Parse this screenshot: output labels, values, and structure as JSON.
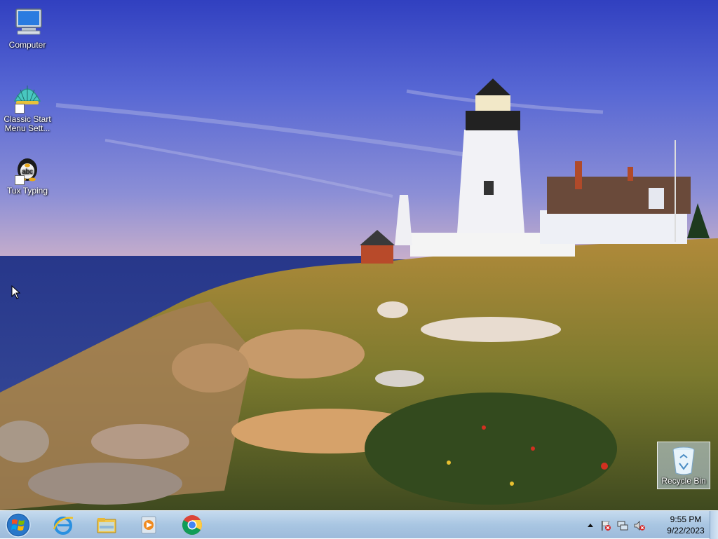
{
  "desktop": {
    "icons": [
      {
        "label": "Computer",
        "icon": "computer-icon"
      },
      {
        "label": "Classic Start Menu Sett...",
        "icon": "classic-shell-icon"
      },
      {
        "label": "Tux Typing",
        "icon": "tux-typing-icon"
      }
    ],
    "recycle_bin": {
      "label": "Recycle Bin",
      "icon": "recycle-bin-icon"
    }
  },
  "taskbar": {
    "start": {
      "icon": "windows-start-orb-icon"
    },
    "pinned": [
      {
        "name": "Internet Explorer",
        "icon": "internet-explorer-icon"
      },
      {
        "name": "Windows Explorer",
        "icon": "file-explorer-icon"
      },
      {
        "name": "Windows Media Player",
        "icon": "media-player-icon"
      },
      {
        "name": "Google Chrome",
        "icon": "chrome-icon"
      }
    ],
    "tray": {
      "icons": [
        "show-hidden-icons-arrow",
        "action-center-flag-icon",
        "network-icon",
        "volume-muted-icon"
      ],
      "time": "9:55 PM",
      "date": "9/22/2023"
    }
  },
  "colors": {
    "taskbar": "#a9c6e2",
    "sky": "#3d4fc8",
    "sea": "#2b3f8c"
  }
}
